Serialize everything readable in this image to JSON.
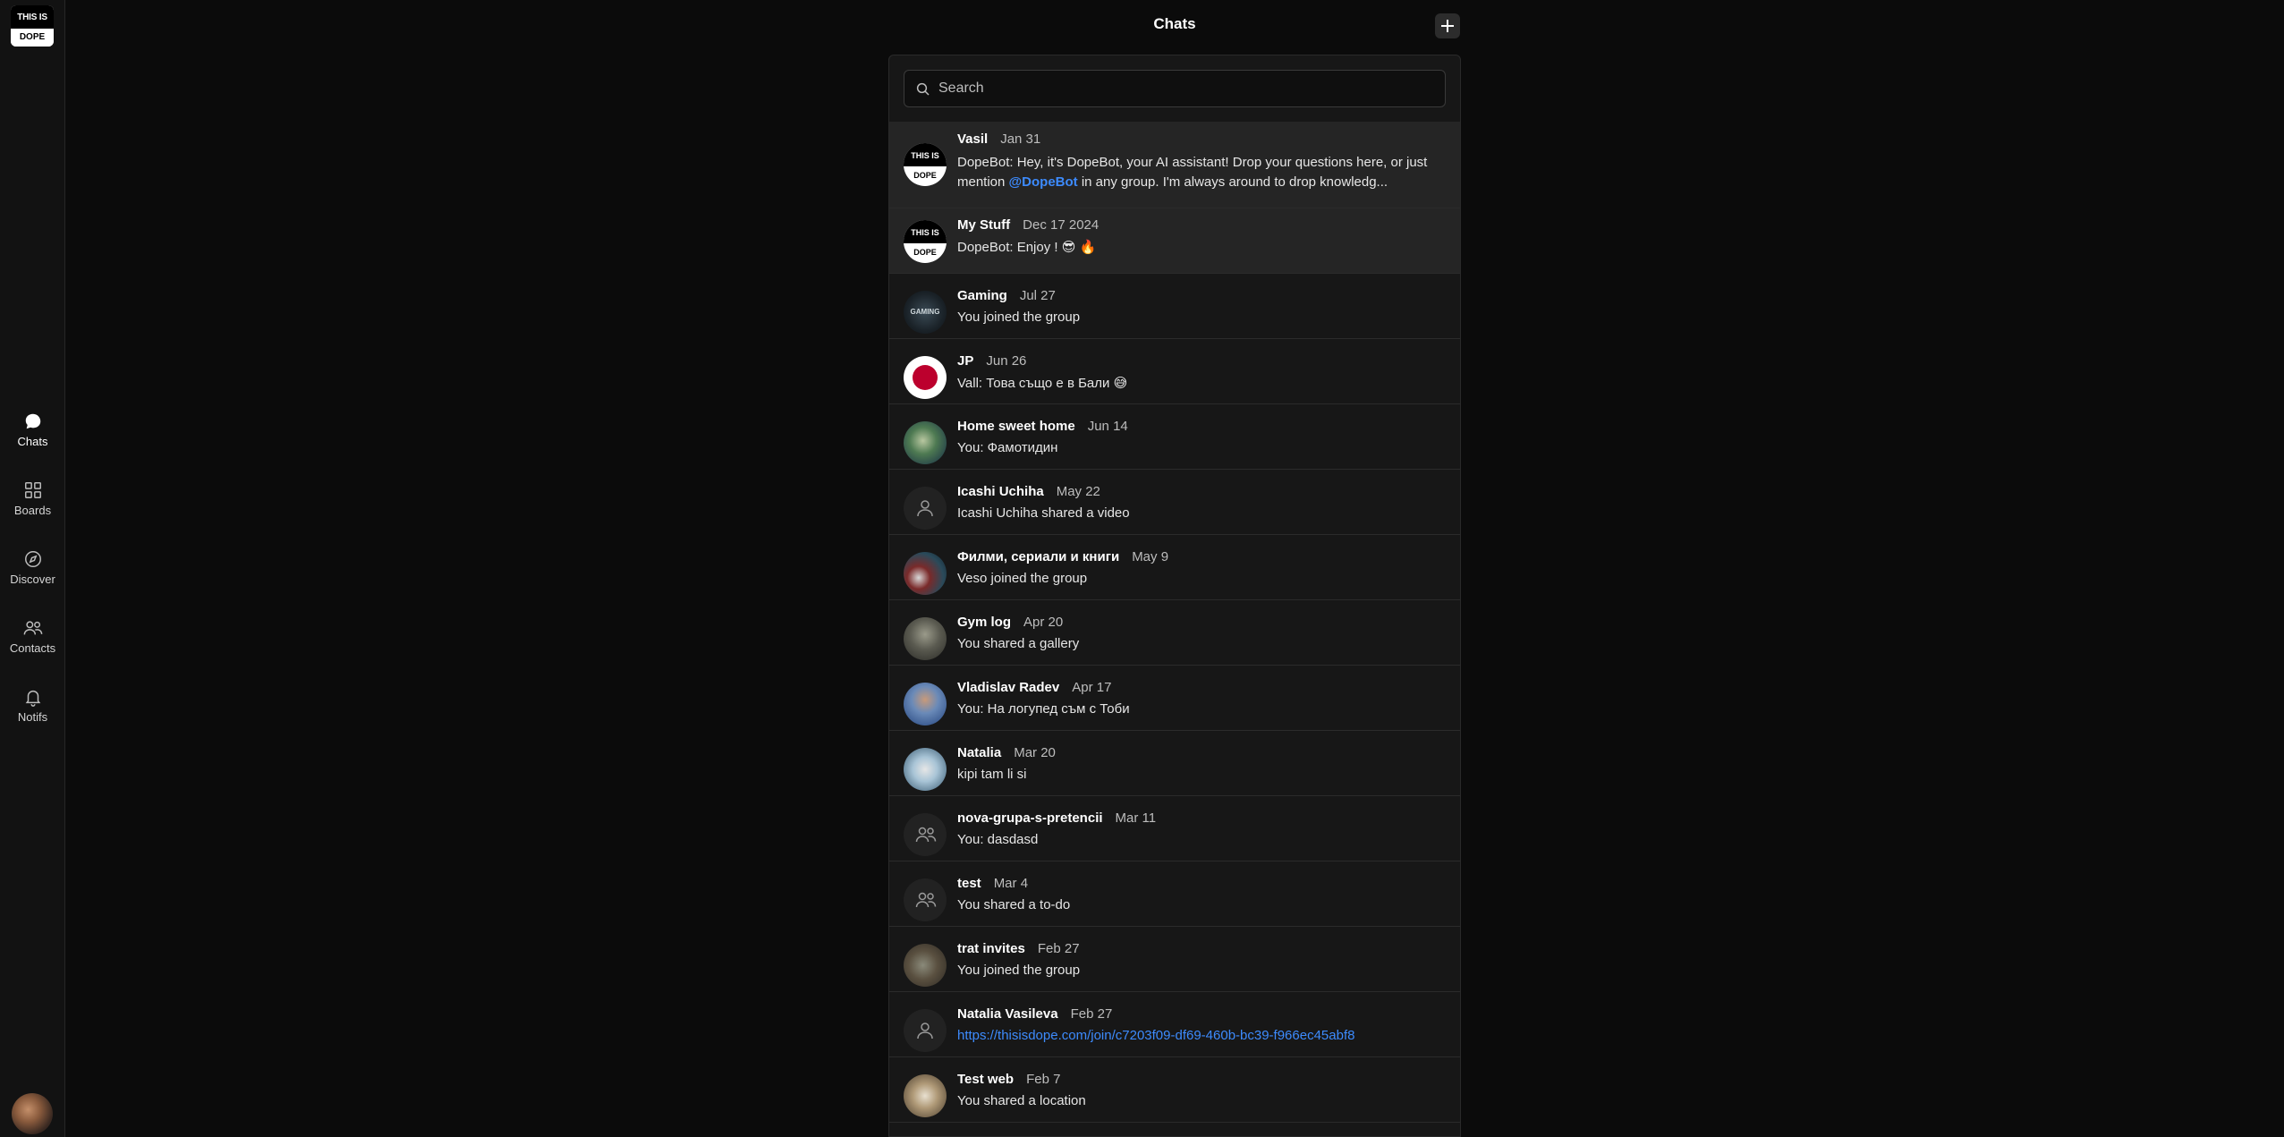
{
  "app": {
    "logo_line1": "THIS IS",
    "logo_line2": "DOPE",
    "title": "Chats"
  },
  "sidebar": {
    "items": [
      {
        "label": "Chats",
        "icon": "chat-bubble-icon",
        "active": true
      },
      {
        "label": "Boards",
        "icon": "grid-icon",
        "active": false
      },
      {
        "label": "Discover",
        "icon": "compass-icon",
        "active": false
      },
      {
        "label": "Contacts",
        "icon": "people-icon",
        "active": false
      },
      {
        "label": "Notifs",
        "icon": "bell-icon",
        "active": false
      }
    ]
  },
  "search": {
    "placeholder": "Search"
  },
  "chats": [
    {
      "name": "Vasil",
      "date": "Jan 31",
      "message_prefix": "DopeBot: Hey, it's DopeBot, your AI assistant! Drop your questions here, or just mention ",
      "mention": "@DopeBot",
      "message_suffix": " in any group. I'm always around to drop knowledg...",
      "avatar": "dope"
    },
    {
      "name": "My Stuff",
      "date": "Dec 17 2024",
      "message": "DopeBot: Enjoy ! 😎 🔥",
      "avatar": "dope"
    },
    {
      "name": "Gaming",
      "date": "Jul 27",
      "message": "You joined the group",
      "avatar": "gaming",
      "avatar_text": "GAMING"
    },
    {
      "name": "JP",
      "date": "Jun 26",
      "message": "Vall: Това също е в Бали 😅",
      "avatar": "jp"
    },
    {
      "name": "Home sweet home",
      "date": "Jun 14",
      "message": "You: Фамотидин",
      "avatar": "photo"
    },
    {
      "name": "Icashi Uchiha",
      "date": "May 22",
      "message": "Icashi Uchiha shared a video",
      "avatar": "person-placeholder"
    },
    {
      "name": "Филми, сериали и книги",
      "date": "May 9",
      "message": "Veso joined the group",
      "avatar": "photo"
    },
    {
      "name": "Gym log",
      "date": "Apr 20",
      "message": "You shared a gallery",
      "avatar": "photo"
    },
    {
      "name": "Vladislav Radev",
      "date": "Apr 17",
      "message": "You: На логупед съм с Тоби",
      "avatar": "photo"
    },
    {
      "name": "Natalia",
      "date": "Mar 20",
      "message": "kipi tam li si",
      "avatar": "photo"
    },
    {
      "name": "nova-grupa-s-pretencii",
      "date": "Mar 11",
      "message": "You: dasdasd",
      "avatar": "group-placeholder"
    },
    {
      "name": "test",
      "date": "Mar 4",
      "message": "You shared a to-do",
      "avatar": "group-placeholder"
    },
    {
      "name": "trat invites",
      "date": "Feb 27",
      "message": "You joined the group",
      "avatar": "photo"
    },
    {
      "name": "Natalia Vasileva",
      "date": "Feb 27",
      "message": "https://thisisdope.com/join/c7203f09-df69-460b-bc39-f966ec45abf8",
      "avatar": "person-placeholder",
      "message_is_link": true
    },
    {
      "name": "Test web",
      "date": "Feb 7",
      "message": "You shared a location",
      "avatar": "photo"
    }
  ],
  "colors": {
    "background": "#0b0b0b",
    "panel": "#171717",
    "highlight_row": "#252525",
    "accent_link": "#3d8bfd"
  }
}
